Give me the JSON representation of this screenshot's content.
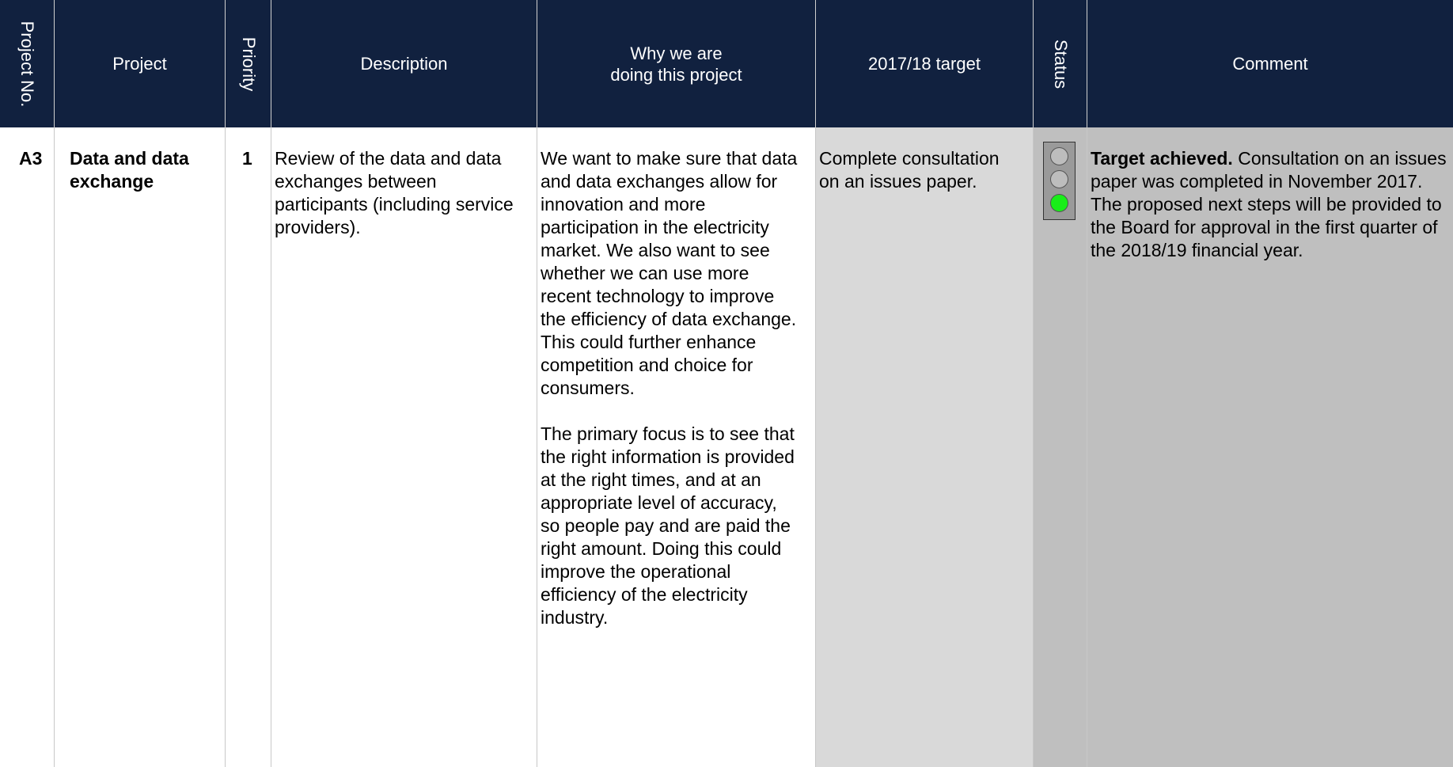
{
  "headers": {
    "project_no": "Project No.",
    "project": "Project",
    "priority": "Priority",
    "description": "Description",
    "why": "Why we are doing this project",
    "target": "2017/18 target",
    "status": "Status",
    "comment": "Comment"
  },
  "row": {
    "project_no": "A3",
    "project": "Data and data exchange",
    "priority": "1",
    "description": "Review of the data and data exchanges between participants (including service providers).",
    "why_p1": "We want to make sure that data and data exchanges allow for innovation and more participation in the electricity market. We also want to see whether we can use more recent technology to improve the efficiency of data exchange. This could further enhance competition and choice for consumers.",
    "why_p2": "The primary focus is to see that the right information is provided at the right times, and at an appropriate level of accuracy, so people pay and are paid the right amount. Doing this could improve the operational efficiency of the electricity industry.",
    "target": "Complete consultation on an issues paper.",
    "status": "green",
    "comment_bold": "Target achieved.",
    "comment_rest": " Consultation on an issues paper was completed in November 2017. The proposed next steps will be provided to the Board for approval in the first quarter of the 2018/19 financial year."
  },
  "colors": {
    "header_bg": "#11213f",
    "target_col_bg": "#d9d9d9",
    "status_col_bg": "#bfbfbf",
    "status_green": "#19ee19",
    "status_off": "#bdbdbd"
  }
}
